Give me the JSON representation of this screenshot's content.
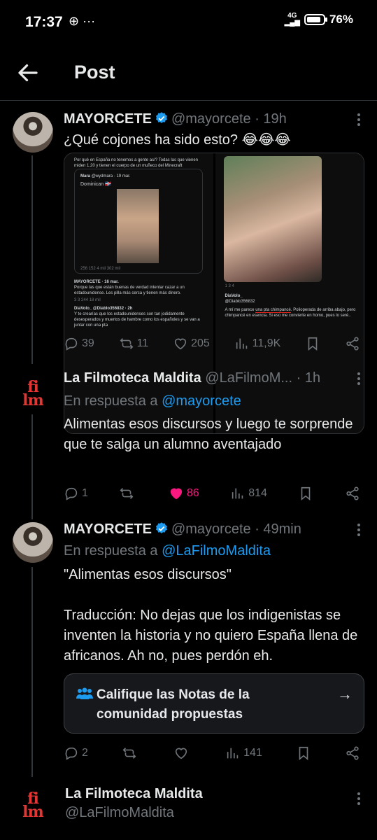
{
  "status_bar": {
    "time": "17:37",
    "left_icons": "⊕ ···",
    "network": "4G",
    "battery": "76%"
  },
  "header": {
    "title": "Post"
  },
  "posts": [
    {
      "name": "MAYORCETE",
      "handle": "@mayorcete",
      "time": "· 19h",
      "text": "¿Qué cojones ha sido esto? 😂😂😂",
      "media": {
        "left_top_text": "Por qué en España no tenemos a gente así? Todas las que vienen miden 1.20 y tienen el cuerpo de un muñeco del Minecraft",
        "left_quote_name": "Mara",
        "left_quote_sub": "@wydmara · 19 mar.",
        "left_quote_text": "Dominican 🇩🇴",
        "left_stats": "256   152   4 mil   302 mil",
        "left_reply1_name": "MAYORCETE · 16 mar.",
        "left_reply1_text": "Porque las que están buenas de verdad intentar cazar a un estadounidense. Les pilla más cerca y tienen más dinero.",
        "left_reply1_stats": "3   3   244   18 mil",
        "left_reply2_name": "DiaVolo_ @Diablo356832 · 2h",
        "left_reply2_text": "Y te crearías que los estadounidenses son tan jodidamente desesperados y muertos de hambre como los españoles y se van a juntar con una pta",
        "right_stats": "1   3   4",
        "right_reply_name": "DiaVolo_",
        "right_reply_sub": "@Diablo356832",
        "right_reply_pre": "A mí me parece ",
        "right_reply_underlined": "una pta chimpancé",
        "right_reply_post": ". Polioperada de arriba abajo, pero chimpancé en esencia. Si eso me convierte en homo, pues lo seré.."
      },
      "actions": {
        "replies": "39",
        "reposts": "11",
        "likes": "205",
        "views": "11,9K"
      }
    },
    {
      "name": "La Filmoteca Maldita",
      "handle": "@LaFilmoM...",
      "time": "· 1h",
      "reply_prefix": "En respuesta a ",
      "reply_to": "@mayorcete",
      "text": "Alimentas esos discursos y luego te sorprende que te salga un alumno aventajado",
      "actions": {
        "replies": "1",
        "reposts": "",
        "likes": "86",
        "views": "814"
      }
    },
    {
      "name": "MAYORCETE",
      "handle": "@mayorcete",
      "time": "· 49min",
      "reply_prefix": "En respuesta a ",
      "reply_to": "@LaFilmoMaldita",
      "text": "\"Alimentas esos discursos\"\n\nTraducción: No dejas que los indigenistas se inventen la historia y no quiero España llena de africanos. Ah no, pues perdón eh.",
      "notes_label": "Califique las Notas de la comunidad propuestas",
      "actions": {
        "replies": "2",
        "reposts": "",
        "likes": "",
        "views": "141"
      }
    },
    {
      "name": "La Filmoteca Maldita",
      "handle": "@LaFilmoMaldita"
    }
  ],
  "logo_text": "film",
  "colors": {
    "accent": "#1d9bf0",
    "like": "#f91880",
    "background": "#000000",
    "muted": "#71767b",
    "logo_red": "#e03634"
  }
}
